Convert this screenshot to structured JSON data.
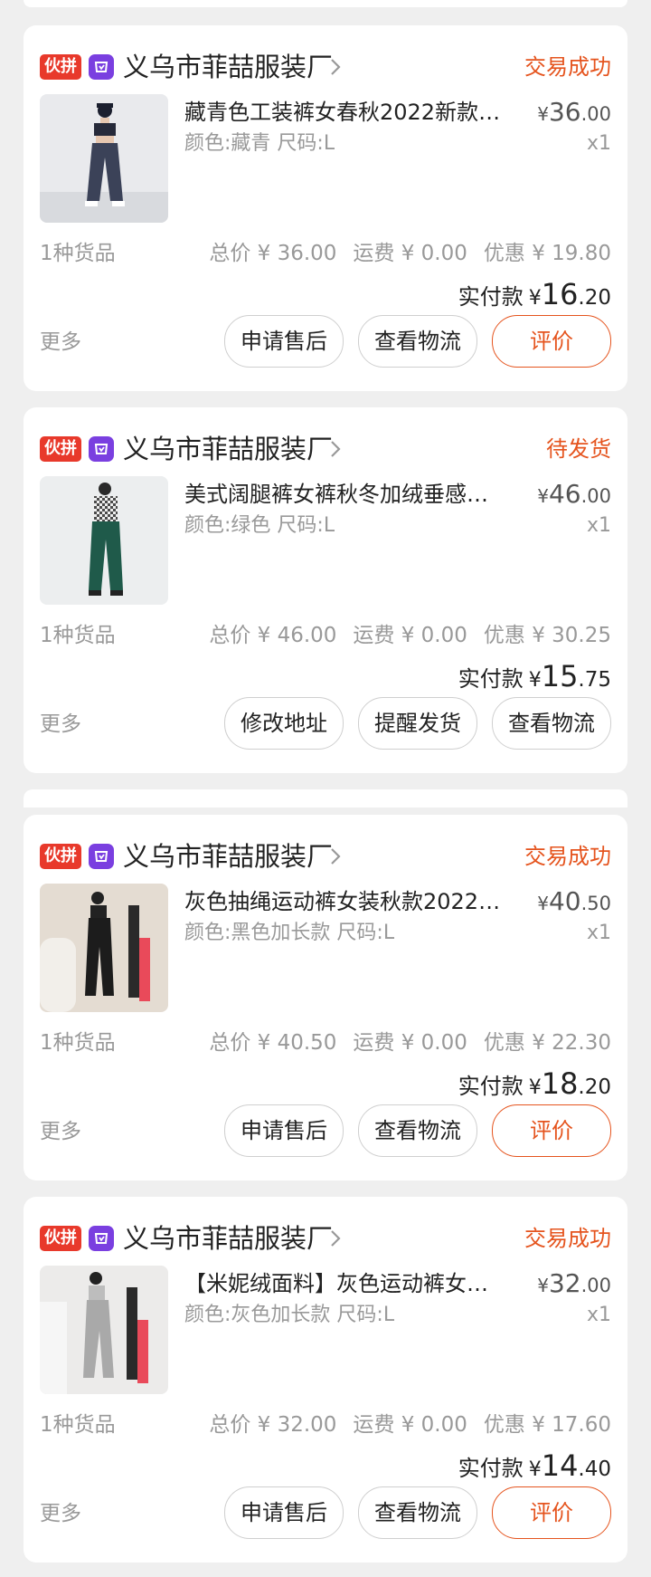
{
  "colors": {
    "accent": "#e5541e",
    "badge_red": "#e8392b",
    "shop_icon_purple": "#7a3fe0"
  },
  "orders": [
    {
      "badge": "伙拼",
      "shop_name": "义乌市菲喆服装厂",
      "status": "交易成功",
      "title": "藏青色工装裤女春秋2022新款…",
      "spec": "颜色:藏青 尺码:L",
      "price": {
        "currency": "¥",
        "int": "36",
        "dec": ".00"
      },
      "qty": "x1",
      "goods_count": "1种货品",
      "total": "总价 ¥ 36.00",
      "shipping": "运费 ¥ 0.00",
      "discount": "优惠 ¥ 19.80",
      "paid": {
        "label": "实付款",
        "currency": "¥",
        "int": "16",
        "dec": ".20"
      },
      "more": "更多",
      "buttons": [
        "申请售后",
        "查看物流",
        "评价"
      ]
    },
    {
      "badge": "伙拼",
      "shop_name": "义乌市菲喆服装厂",
      "status": "待发货",
      "title": "美式阔腿裤女裤秋冬加绒垂感…",
      "spec": "颜色:绿色 尺码:L",
      "price": {
        "currency": "¥",
        "int": "46",
        "dec": ".00"
      },
      "qty": "x1",
      "goods_count": "1种货品",
      "total": "总价 ¥ 46.00",
      "shipping": "运费 ¥ 0.00",
      "discount": "优惠 ¥ 30.25",
      "paid": {
        "label": "实付款",
        "currency": "¥",
        "int": "15",
        "dec": ".75"
      },
      "more": "更多",
      "buttons": [
        "修改地址",
        "提醒发货",
        "查看物流"
      ]
    },
    {
      "badge": "伙拼",
      "shop_name": "义乌市菲喆服装厂",
      "status": "交易成功",
      "title": "灰色抽绳运动裤女装秋款2022…",
      "spec": "颜色:黑色加长款 尺码:L",
      "price": {
        "currency": "¥",
        "int": "40",
        "dec": ".50"
      },
      "qty": "x1",
      "goods_count": "1种货品",
      "total": "总价 ¥ 40.50",
      "shipping": "运费 ¥ 0.00",
      "discount": "优惠 ¥ 22.30",
      "paid": {
        "label": "实付款",
        "currency": "¥",
        "int": "18",
        "dec": ".20"
      },
      "more": "更多",
      "buttons": [
        "申请售后",
        "查看物流",
        "评价"
      ]
    },
    {
      "badge": "伙拼",
      "shop_name": "义乌市菲喆服装厂",
      "status": "交易成功",
      "title": "【米妮绒面料】灰色运动裤女…",
      "spec": "颜色:灰色加长款 尺码:L",
      "price": {
        "currency": "¥",
        "int": "32",
        "dec": ".00"
      },
      "qty": "x1",
      "goods_count": "1种货品",
      "total": "总价 ¥ 32.00",
      "shipping": "运费 ¥ 0.00",
      "discount": "优惠 ¥ 17.60",
      "paid": {
        "label": "实付款",
        "currency": "¥",
        "int": "14",
        "dec": ".40"
      },
      "more": "更多",
      "buttons": [
        "申请售后",
        "查看物流",
        "评价"
      ]
    }
  ]
}
